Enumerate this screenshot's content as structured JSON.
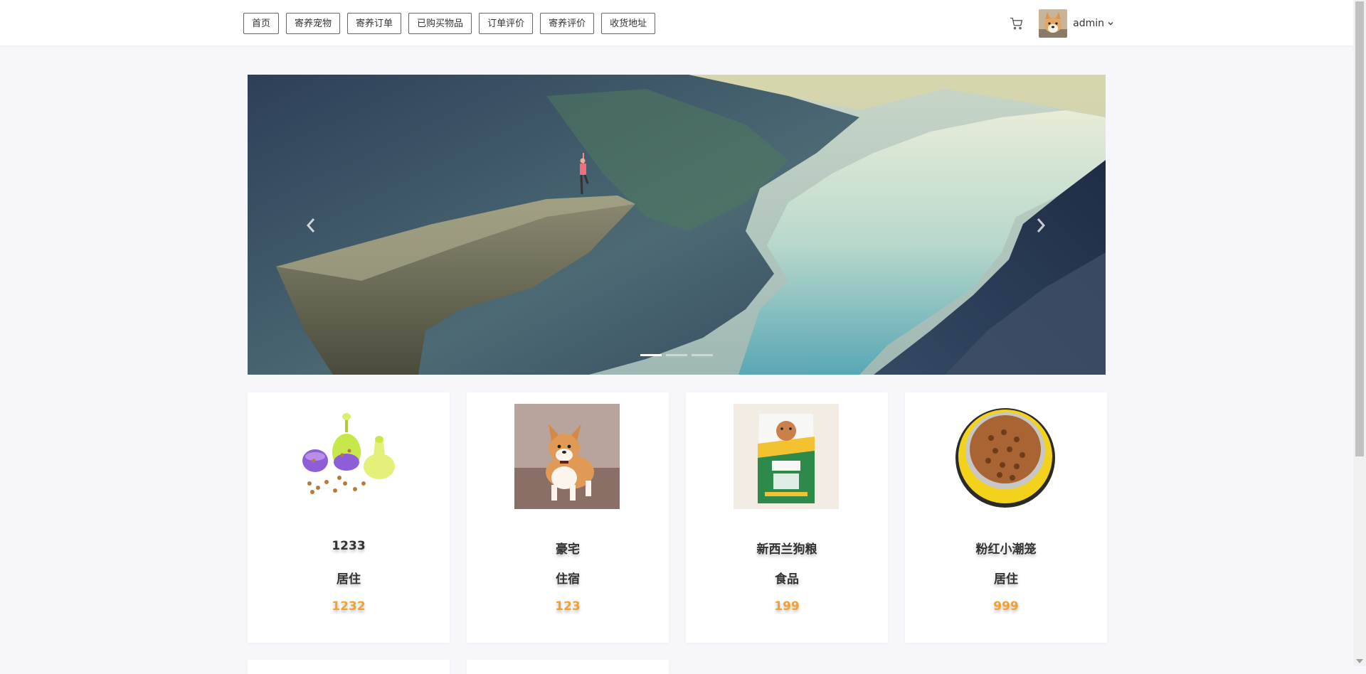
{
  "nav": {
    "items": [
      {
        "label": "首页"
      },
      {
        "label": "寄养宠物"
      },
      {
        "label": "寄养订单"
      },
      {
        "label": "已购买物品"
      },
      {
        "label": "订单评价"
      },
      {
        "label": "寄养评价"
      },
      {
        "label": "收货地址"
      }
    ]
  },
  "user": {
    "name": "admin",
    "avatar_icon": "dog-avatar"
  },
  "icons": {
    "cart": "cart-icon",
    "chevron": "chevron-down-icon",
    "prev": "chevron-left-icon",
    "next": "chevron-right-icon"
  },
  "banner": {
    "slide_count": 3,
    "active_slide": 0
  },
  "products": [
    {
      "name": "1233",
      "category": "居住",
      "price": "1232",
      "image": "pet-toy-balls"
    },
    {
      "name": "豪宅",
      "category": "住宿",
      "price": "123",
      "image": "corgi-dog"
    },
    {
      "name": "新西兰狗粮",
      "category": "食品",
      "price": "199",
      "image": "dog-food-bag"
    },
    {
      "name": "粉红小潮笼",
      "category": "居住",
      "price": "999",
      "image": "food-bowl"
    }
  ],
  "colors": {
    "price": "#f5a02a",
    "background": "#f7f7fb",
    "nav_border": "#666666"
  }
}
